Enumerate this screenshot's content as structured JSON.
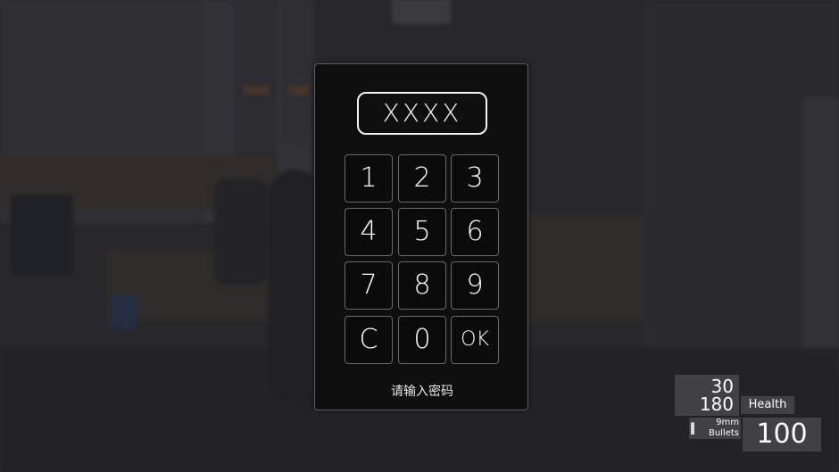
{
  "keypad": {
    "display": "XXXX",
    "keys": [
      "1",
      "2",
      "3",
      "4",
      "5",
      "6",
      "7",
      "8",
      "9",
      "C",
      "0",
      "OK"
    ],
    "prompt": "请输入密码"
  },
  "hud": {
    "ammo_clip": "30",
    "ammo_reserve": "180",
    "health_label": "Health",
    "health_value": "100",
    "weapon_caliber": "9mm",
    "weapon_ammo_type": "Bullets"
  },
  "icons": {
    "bullet": "bullet-icon"
  }
}
